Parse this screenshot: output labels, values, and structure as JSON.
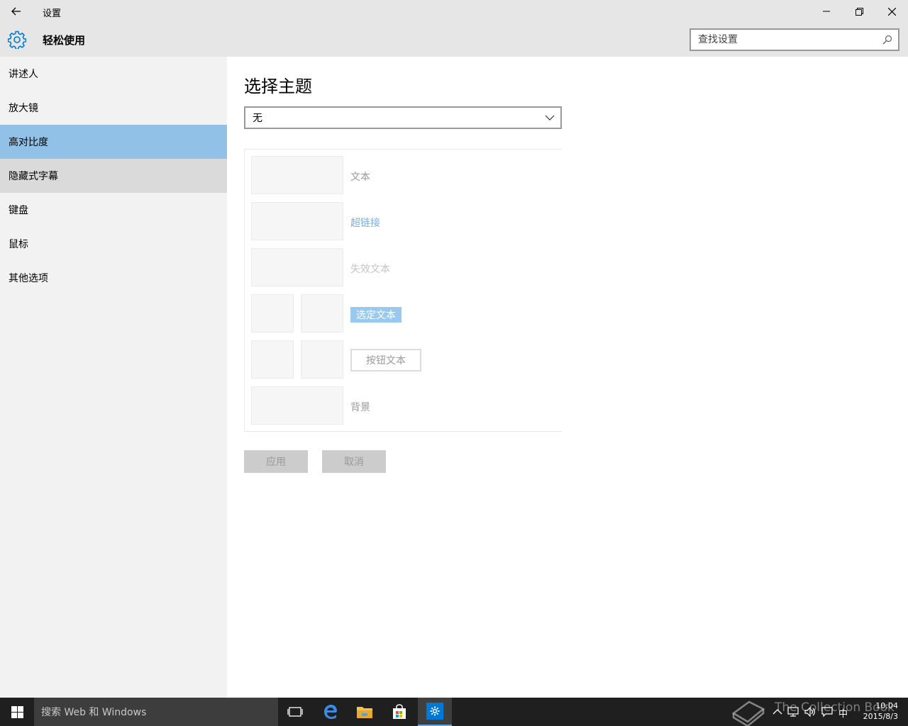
{
  "window": {
    "title": "设置"
  },
  "header": {
    "section_title": "轻松使用",
    "search_placeholder": "查找设置"
  },
  "sidebar": {
    "items": [
      {
        "label": "讲述人"
      },
      {
        "label": "放大镜"
      },
      {
        "label": "高对比度"
      },
      {
        "label": "隐藏式字幕"
      },
      {
        "label": "键盘"
      },
      {
        "label": "鼠标"
      },
      {
        "label": "其他选项"
      }
    ],
    "selected_index": 2
  },
  "main": {
    "title": "选择主题",
    "theme_value": "无",
    "preview": {
      "text": "文本",
      "hyperlink": "超链接",
      "disabled_text": "失效文本",
      "selected_text": "选定文本",
      "button_text": "按钮文本",
      "background": "背景"
    },
    "apply_label": "应用",
    "cancel_label": "取消"
  },
  "taskbar": {
    "search_placeholder": "搜索 Web 和 Windows",
    "ime": "中",
    "time": "10:04",
    "date": "2015/8/3",
    "watermark": "The Collection Book"
  },
  "colors": {
    "selected_nav": "#91c1e7",
    "accent": "#0078d7",
    "taskbar": "#1f1f1f"
  }
}
